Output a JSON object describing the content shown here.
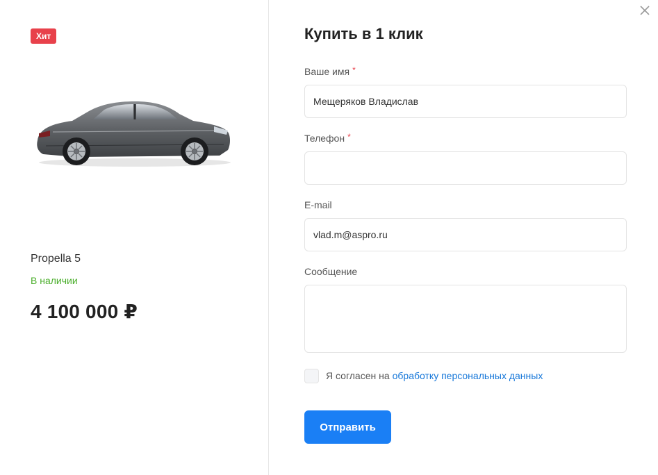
{
  "product": {
    "badge": "Хит",
    "name": "Propella 5",
    "stock": "В наличии",
    "price": "4 100 000 ₽",
    "image_icon": "car-image"
  },
  "form": {
    "title": "Купить в 1 клик",
    "name_label": "Ваше имя",
    "name_value": "Мещеряков Владислав",
    "phone_label": "Телефон",
    "phone_value": "",
    "email_label": "E-mail",
    "email_value": "vlad.m@aspro.ru",
    "message_label": "Сообщение",
    "message_value": "",
    "required_mark": "*",
    "consent_text": "Я согласен на",
    "consent_link": "обработку персональных данных",
    "submit_label": "Отправить"
  },
  "colors": {
    "badge": "#e8414b",
    "stock": "#4caf2d",
    "accent": "#1a7ff5",
    "link": "#1677d9"
  }
}
